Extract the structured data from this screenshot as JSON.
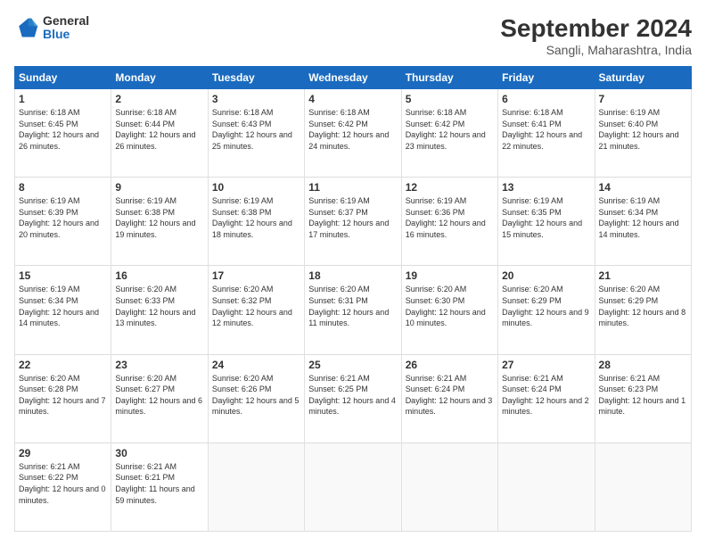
{
  "logo": {
    "general": "General",
    "blue": "Blue"
  },
  "header": {
    "month": "September 2024",
    "location": "Sangli, Maharashtra, India"
  },
  "weekdays": [
    "Sunday",
    "Monday",
    "Tuesday",
    "Wednesday",
    "Thursday",
    "Friday",
    "Saturday"
  ],
  "weeks": [
    [
      {
        "day": "1",
        "sunrise": "6:18 AM",
        "sunset": "6:45 PM",
        "daylight": "12 hours and 26 minutes."
      },
      {
        "day": "2",
        "sunrise": "6:18 AM",
        "sunset": "6:44 PM",
        "daylight": "12 hours and 26 minutes."
      },
      {
        "day": "3",
        "sunrise": "6:18 AM",
        "sunset": "6:43 PM",
        "daylight": "12 hours and 25 minutes."
      },
      {
        "day": "4",
        "sunrise": "6:18 AM",
        "sunset": "6:42 PM",
        "daylight": "12 hours and 24 minutes."
      },
      {
        "day": "5",
        "sunrise": "6:18 AM",
        "sunset": "6:42 PM",
        "daylight": "12 hours and 23 minutes."
      },
      {
        "day": "6",
        "sunrise": "6:18 AM",
        "sunset": "6:41 PM",
        "daylight": "12 hours and 22 minutes."
      },
      {
        "day": "7",
        "sunrise": "6:19 AM",
        "sunset": "6:40 PM",
        "daylight": "12 hours and 21 minutes."
      }
    ],
    [
      {
        "day": "8",
        "sunrise": "6:19 AM",
        "sunset": "6:39 PM",
        "daylight": "12 hours and 20 minutes."
      },
      {
        "day": "9",
        "sunrise": "6:19 AM",
        "sunset": "6:38 PM",
        "daylight": "12 hours and 19 minutes."
      },
      {
        "day": "10",
        "sunrise": "6:19 AM",
        "sunset": "6:38 PM",
        "daylight": "12 hours and 18 minutes."
      },
      {
        "day": "11",
        "sunrise": "6:19 AM",
        "sunset": "6:37 PM",
        "daylight": "12 hours and 17 minutes."
      },
      {
        "day": "12",
        "sunrise": "6:19 AM",
        "sunset": "6:36 PM",
        "daylight": "12 hours and 16 minutes."
      },
      {
        "day": "13",
        "sunrise": "6:19 AM",
        "sunset": "6:35 PM",
        "daylight": "12 hours and 15 minutes."
      },
      {
        "day": "14",
        "sunrise": "6:19 AM",
        "sunset": "6:34 PM",
        "daylight": "12 hours and 14 minutes."
      }
    ],
    [
      {
        "day": "15",
        "sunrise": "6:19 AM",
        "sunset": "6:34 PM",
        "daylight": "12 hours and 14 minutes."
      },
      {
        "day": "16",
        "sunrise": "6:20 AM",
        "sunset": "6:33 PM",
        "daylight": "12 hours and 13 minutes."
      },
      {
        "day": "17",
        "sunrise": "6:20 AM",
        "sunset": "6:32 PM",
        "daylight": "12 hours and 12 minutes."
      },
      {
        "day": "18",
        "sunrise": "6:20 AM",
        "sunset": "6:31 PM",
        "daylight": "12 hours and 11 minutes."
      },
      {
        "day": "19",
        "sunrise": "6:20 AM",
        "sunset": "6:30 PM",
        "daylight": "12 hours and 10 minutes."
      },
      {
        "day": "20",
        "sunrise": "6:20 AM",
        "sunset": "6:29 PM",
        "daylight": "12 hours and 9 minutes."
      },
      {
        "day": "21",
        "sunrise": "6:20 AM",
        "sunset": "6:29 PM",
        "daylight": "12 hours and 8 minutes."
      }
    ],
    [
      {
        "day": "22",
        "sunrise": "6:20 AM",
        "sunset": "6:28 PM",
        "daylight": "12 hours and 7 minutes."
      },
      {
        "day": "23",
        "sunrise": "6:20 AM",
        "sunset": "6:27 PM",
        "daylight": "12 hours and 6 minutes."
      },
      {
        "day": "24",
        "sunrise": "6:20 AM",
        "sunset": "6:26 PM",
        "daylight": "12 hours and 5 minutes."
      },
      {
        "day": "25",
        "sunrise": "6:21 AM",
        "sunset": "6:25 PM",
        "daylight": "12 hours and 4 minutes."
      },
      {
        "day": "26",
        "sunrise": "6:21 AM",
        "sunset": "6:24 PM",
        "daylight": "12 hours and 3 minutes."
      },
      {
        "day": "27",
        "sunrise": "6:21 AM",
        "sunset": "6:24 PM",
        "daylight": "12 hours and 2 minutes."
      },
      {
        "day": "28",
        "sunrise": "6:21 AM",
        "sunset": "6:23 PM",
        "daylight": "12 hours and 1 minute."
      }
    ],
    [
      {
        "day": "29",
        "sunrise": "6:21 AM",
        "sunset": "6:22 PM",
        "daylight": "12 hours and 0 minutes."
      },
      {
        "day": "30",
        "sunrise": "6:21 AM",
        "sunset": "6:21 PM",
        "daylight": "11 hours and 59 minutes."
      },
      null,
      null,
      null,
      null,
      null
    ]
  ]
}
